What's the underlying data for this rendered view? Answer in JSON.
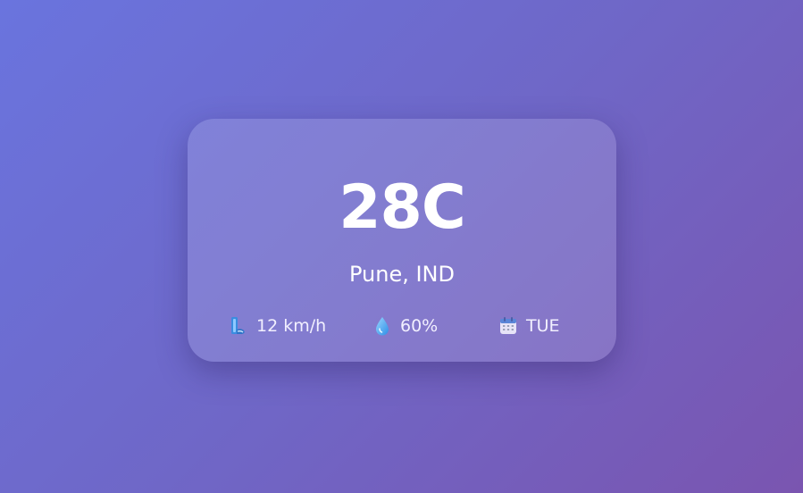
{
  "weather": {
    "temperature": "28C",
    "location": "Pune, IND",
    "wind": {
      "icon": "wind-icon",
      "value": "12 km/h"
    },
    "humidity": {
      "icon": "droplet-icon",
      "value": "60%"
    },
    "day": {
      "icon": "calendar-icon",
      "value": "TUE"
    }
  },
  "colors": {
    "background_start": "#6a74de",
    "background_end": "#7a55b0",
    "card_text": "#ffffff"
  }
}
